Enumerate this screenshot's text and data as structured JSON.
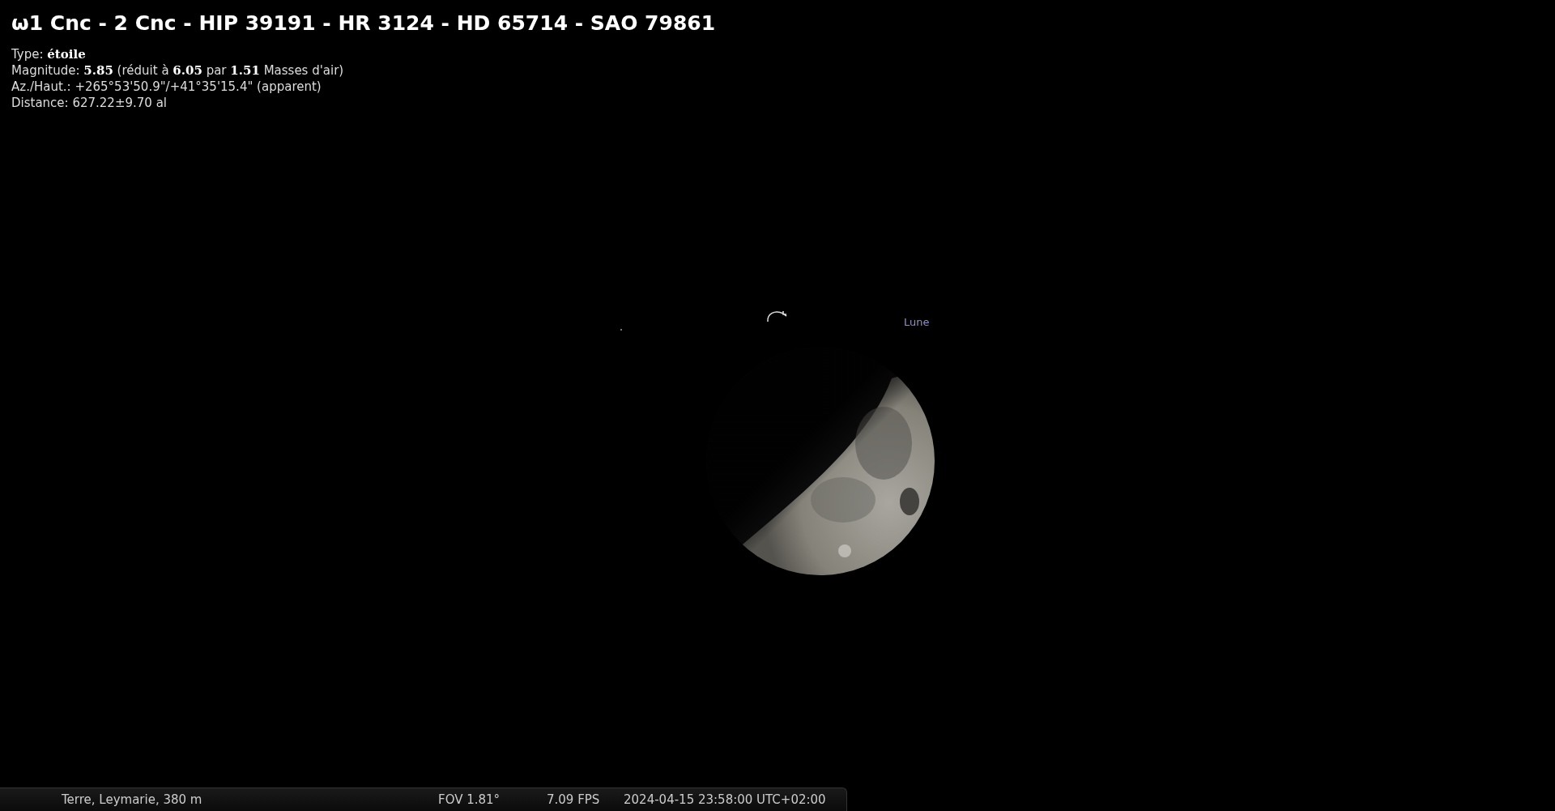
{
  "object_info": {
    "title": "ω1 Cnc - 2 Cnc - HIP 39191 - HR 3124 - HD 65714 - SAO 79861",
    "lines": [
      "Type: **étoile**",
      "Magnitude: **5.85** (réduit à **6.05** par **1.51** Masses d'air)",
      "Az./Haut.: +265°53'50.9\"/+41°35'15.4\" (apparent)",
      "Distance: 627.22±9.70 al"
    ]
  },
  "sky": {
    "moon_label": "Lune"
  },
  "status_bar": {
    "location": "Terre, Leymarie, 380 m",
    "fov": "FOV 1.81°",
    "fps": "7.09 FPS",
    "datetime": "2024-04-15 23:58:00 UTC+02:00"
  }
}
